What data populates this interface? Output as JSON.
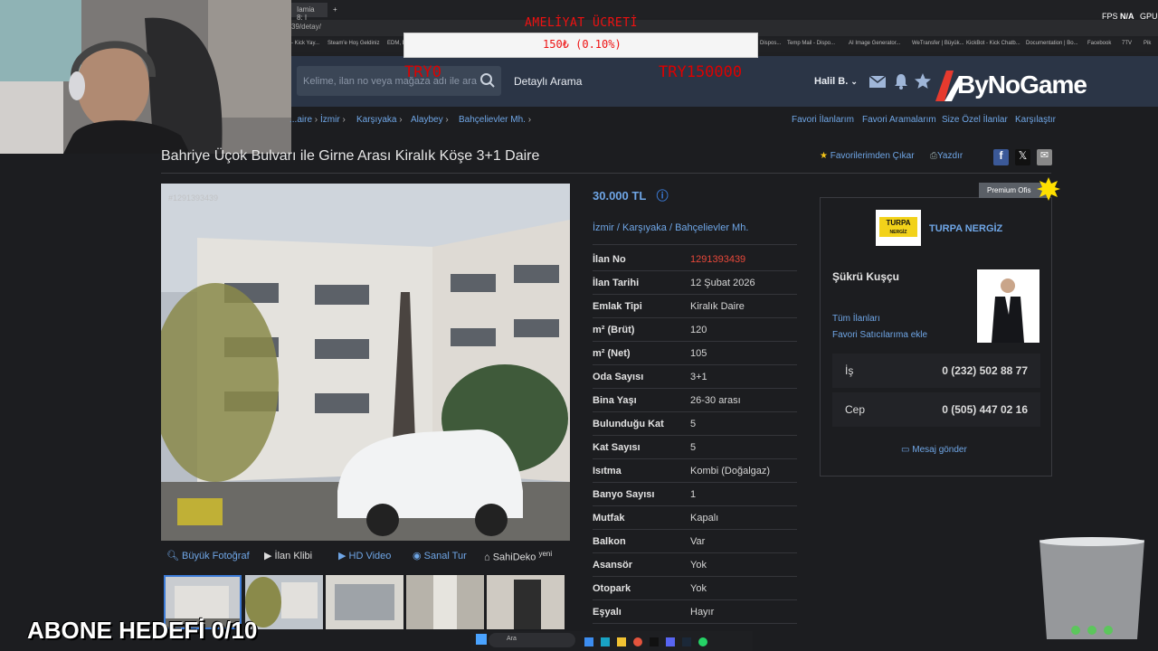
{
  "browser": {
    "tabs": [
      "Iamia 8: I"
    ],
    "url": "39/detay/",
    "fps_label": "FPS",
    "fps_value": "N/A",
    "gpu_label": "GPU",
    "bookmarks": [
      "- Kick Yay...",
      "Steam'e Hoş Geldiniz",
      "EDM, E",
      "Dispos...",
      "Temp Mail - Dispo...",
      "AI Image Generator...",
      "WeTransfer | Büyük...",
      "KickBot - Kick Chatb...",
      "Documentation | Bo...",
      "Facebook",
      "7TV",
      "Pik"
    ]
  },
  "overlay": {
    "alert_title": "AMELİYAT ÜCRETİ",
    "alert_value": "150₺ (0.10%)",
    "goal_start": "TRY0",
    "goal_end": "TRY150000",
    "logo": "ByNoGame",
    "subscriber_goal": "ABONE HEDEFİ 0/10"
  },
  "header": {
    "search_placeholder": "Kelime, ilan no veya mağaza adı ile ara",
    "detailed_search": "Detaylı Arama",
    "user": "Halil B."
  },
  "breadcrumb": [
    "...aire",
    "İzmir",
    "Karşıyaka",
    "Alaybey",
    "Bahçelievler Mh."
  ],
  "nav_links": [
    "Favori İlanlarım",
    "Favori Aramalarım",
    "Size Özel İlanlar",
    "Karşılaştır"
  ],
  "listing": {
    "title": "Bahriye Üçok Bulvarı ile Girne Arası Kiralık Köşe 3+1 Daire",
    "fav_remove": "Favorilerimden Çıkar",
    "print": "Yazdır",
    "photo_id": "#1291393439",
    "photo_tabs": [
      "Büyük Fotoğraf",
      "İlan Klibi",
      "HD Video",
      "Sanal Tur",
      "SahiDeko"
    ],
    "sahideko_badge": "yeni",
    "price": "30.000 TL",
    "location": "İzmir / Karşıyaka / Bahçelievler Mh.",
    "details": [
      {
        "label": "İlan No",
        "value": "1291393439"
      },
      {
        "label": "İlan Tarihi",
        "value": "12 Şubat 2026"
      },
      {
        "label": "Emlak Tipi",
        "value": "Kiralık Daire"
      },
      {
        "label": "m² (Brüt)",
        "value": "120"
      },
      {
        "label": "m² (Net)",
        "value": "105"
      },
      {
        "label": "Oda Sayısı",
        "value": "3+1"
      },
      {
        "label": "Bina Yaşı",
        "value": "26-30 arası"
      },
      {
        "label": "Bulunduğu Kat",
        "value": "5"
      },
      {
        "label": "Kat Sayısı",
        "value": "5"
      },
      {
        "label": "Isıtma",
        "value": "Kombi (Doğalgaz)"
      },
      {
        "label": "Banyo Sayısı",
        "value": "1"
      },
      {
        "label": "Mutfak",
        "value": "Kapalı"
      },
      {
        "label": "Balkon",
        "value": "Var"
      },
      {
        "label": "Asansör",
        "value": "Yok"
      },
      {
        "label": "Otopark",
        "value": "Yok"
      },
      {
        "label": "Eşyalı",
        "value": "Hayır"
      }
    ]
  },
  "seller": {
    "badge": "Premium Ofis",
    "logo_text": "TURPA",
    "logo_sub": "NERGİZ",
    "agency": "TURPA NERGİZ",
    "agent": "Şükrü Kuşçu",
    "all_listings": "Tüm İlanları",
    "fav_seller": "Favori Satıcılarıma ekle",
    "phones": [
      {
        "label": "İş",
        "value": "0 (232) 502 88 77"
      },
      {
        "label": "Cep",
        "value": "0 (505) 447 02 16"
      }
    ],
    "message": "Mesaj gönder"
  },
  "taskbar": {
    "search": "Ara"
  },
  "colors": {
    "link": "#6fa6e6",
    "listing_no": "#e8483a",
    "header": "#2b3546"
  }
}
